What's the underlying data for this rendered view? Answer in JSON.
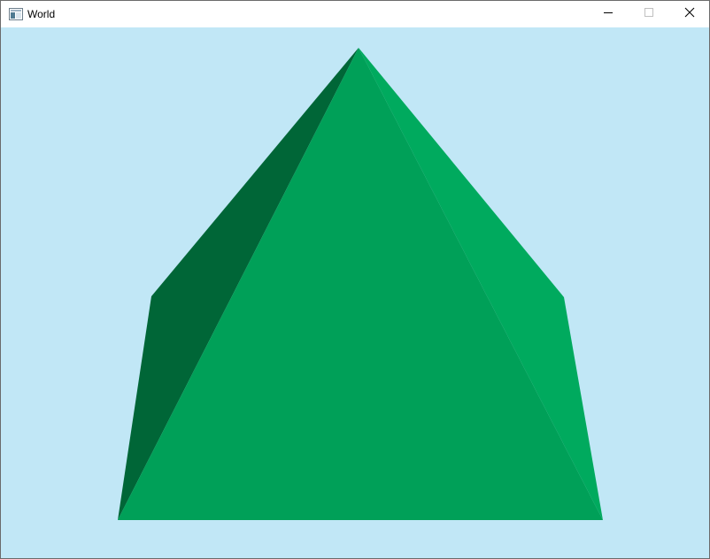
{
  "window": {
    "title": "World"
  },
  "icons": {
    "app": "application-window-icon",
    "minimize": "minimize-icon",
    "maximize": "maximize-icon",
    "close": "close-icon"
  },
  "colors": {
    "sky_background": "#c1e7f6",
    "face_left_dark": "#006637",
    "face_front": "#00a058",
    "face_right_light": "#00aa5e",
    "titlebar": "#ffffff"
  }
}
